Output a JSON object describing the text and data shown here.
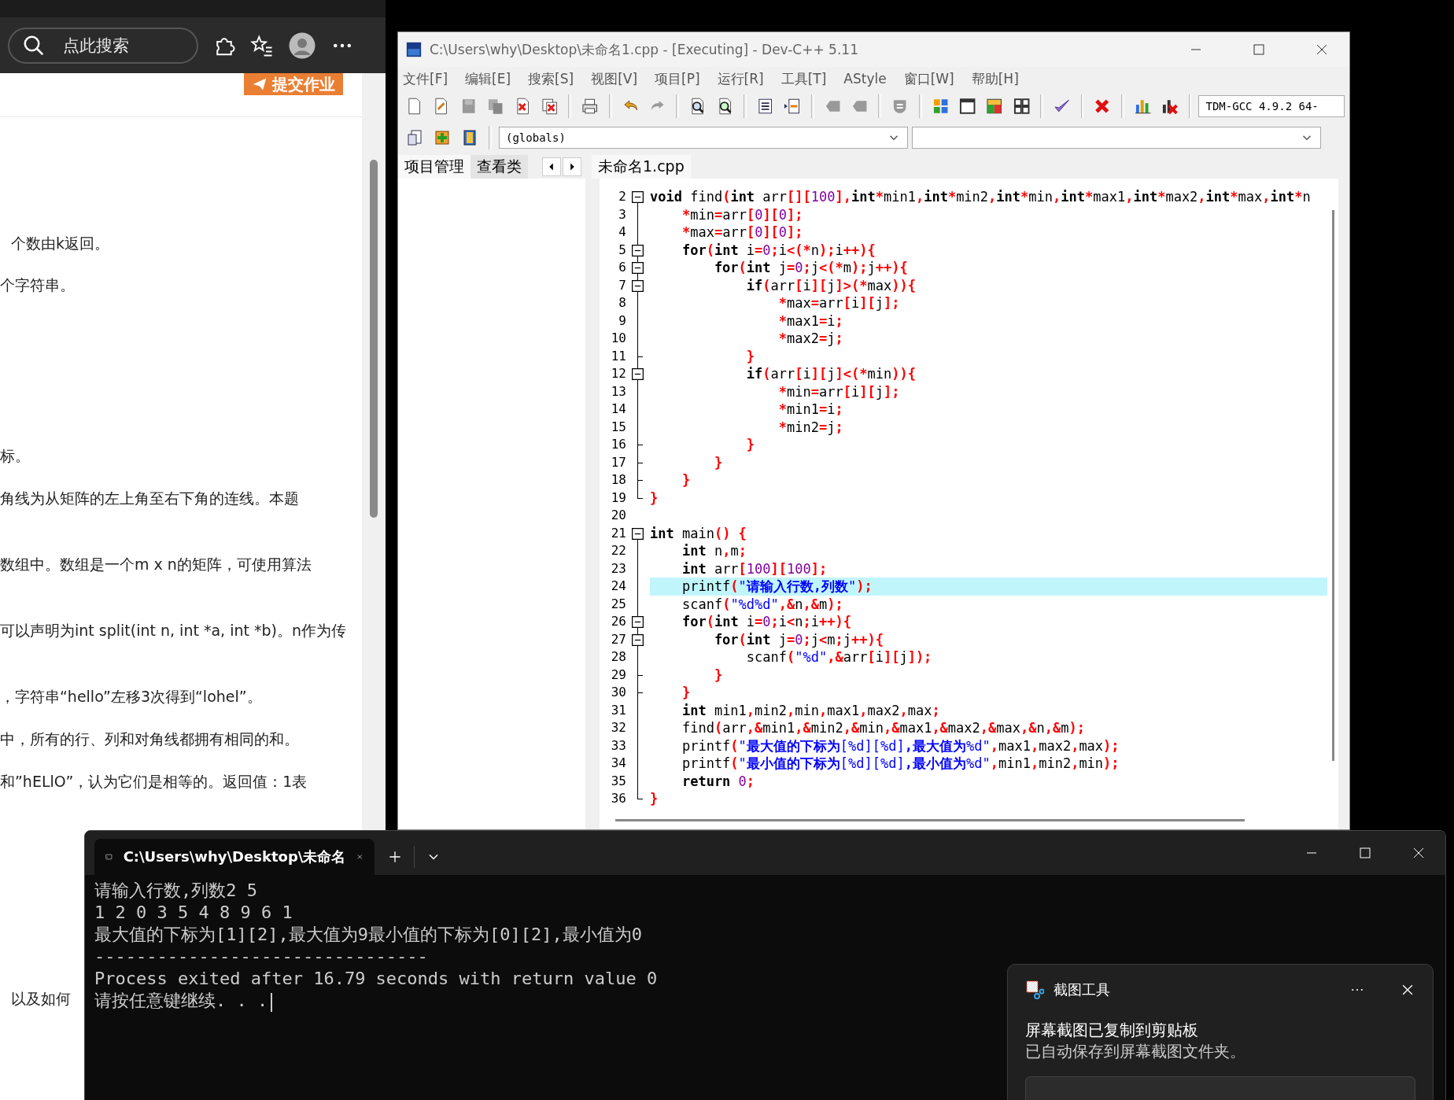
{
  "browser": {
    "search": {
      "placeholder": "点此搜索"
    },
    "submit_button": "提交作业",
    "paragraphs": [
      "个数由k返回。",
      "个字符串。",
      "标。",
      "角线为从矩阵的左上角至右下角的连线。本题",
      "数组中。数组是一个m x n的矩阵，可使用算法",
      "可以声明为int split(int n, int *a, int *b)。n作为传",
      "，字符串“hello”左移3次得到“lohel”。",
      "中，所有的行、列和对角线都拥有相同的和。",
      "和”hELlO”，认为它们是相等的。返回值：1表",
      "以及如何"
    ]
  },
  "devcpp": {
    "title": "C:\\Users\\why\\Desktop\\未命名1.cpp - [Executing] - Dev-C++ 5.11",
    "menu": [
      "文件[F]",
      "编辑[E]",
      "搜索[S]",
      "视图[V]",
      "项目[P]",
      "运行[R]",
      "工具[T]",
      "AStyle",
      "窗口[W]",
      "帮助[H]"
    ],
    "compiler": "TDM-GCC 4.9.2 64-",
    "scope": "(globals)",
    "panel_tabs": [
      {
        "label": "项目管理",
        "selected": true
      },
      {
        "label": "查看类",
        "selected": false
      }
    ],
    "file_tabs": [
      {
        "label": "未命名1.cpp",
        "selected": true
      }
    ],
    "lines": [
      {
        "number": "2",
        "kind": "open",
        "current": false,
        "tokens": [
          {
            "kind": "kw",
            "text": "void"
          },
          {
            "kind": "id",
            "text": " find"
          },
          {
            "kind": "sym",
            "text": "("
          },
          {
            "kind": "kw",
            "text": "int"
          },
          {
            "kind": "id",
            "text": " arr"
          },
          {
            "kind": "sym",
            "text": "[]["
          },
          {
            "kind": "num",
            "text": "100"
          },
          {
            "kind": "sym",
            "text": "],"
          },
          {
            "kind": "kw",
            "text": "int"
          },
          {
            "kind": "sym",
            "text": "*"
          },
          {
            "kind": "id",
            "text": "min1"
          },
          {
            "kind": "sym",
            "text": ","
          },
          {
            "kind": "kw",
            "text": "int"
          },
          {
            "kind": "sym",
            "text": "*"
          },
          {
            "kind": "id",
            "text": "min2"
          },
          {
            "kind": "sym",
            "text": ","
          },
          {
            "kind": "kw",
            "text": "int"
          },
          {
            "kind": "sym",
            "text": "*"
          },
          {
            "kind": "id",
            "text": "min"
          },
          {
            "kind": "sym",
            "text": ","
          },
          {
            "kind": "kw",
            "text": "int"
          },
          {
            "kind": "sym",
            "text": "*"
          },
          {
            "kind": "id",
            "text": "max1"
          },
          {
            "kind": "sym",
            "text": ","
          },
          {
            "kind": "kw",
            "text": "int"
          },
          {
            "kind": "sym",
            "text": "*"
          },
          {
            "kind": "id",
            "text": "max2"
          },
          {
            "kind": "sym",
            "text": ","
          },
          {
            "kind": "kw",
            "text": "int"
          },
          {
            "kind": "sym",
            "text": "*"
          },
          {
            "kind": "id",
            "text": "max"
          },
          {
            "kind": "sym",
            "text": ","
          },
          {
            "kind": "kw",
            "text": "int"
          },
          {
            "kind": "sym",
            "text": "*"
          },
          {
            "kind": "id",
            "text": "n"
          }
        ]
      },
      {
        "number": "3",
        "kind": "line",
        "current": false,
        "tokens": [
          {
            "kind": "sym",
            "text": "    *"
          },
          {
            "kind": "id",
            "text": "min"
          },
          {
            "kind": "sym",
            "text": "="
          },
          {
            "kind": "id",
            "text": "arr"
          },
          {
            "kind": "sym",
            "text": "["
          },
          {
            "kind": "num",
            "text": "0"
          },
          {
            "kind": "sym",
            "text": "]["
          },
          {
            "kind": "num",
            "text": "0"
          },
          {
            "kind": "sym",
            "text": "];"
          }
        ]
      },
      {
        "number": "4",
        "kind": "line",
        "current": false,
        "tokens": [
          {
            "kind": "sym",
            "text": "    *"
          },
          {
            "kind": "id",
            "text": "max"
          },
          {
            "kind": "sym",
            "text": "="
          },
          {
            "kind": "id",
            "text": "arr"
          },
          {
            "kind": "sym",
            "text": "["
          },
          {
            "kind": "num",
            "text": "0"
          },
          {
            "kind": "sym",
            "text": "]["
          },
          {
            "kind": "num",
            "text": "0"
          },
          {
            "kind": "sym",
            "text": "];"
          }
        ]
      },
      {
        "number": "5",
        "kind": "open",
        "current": false,
        "tokens": [
          {
            "kind": "kw",
            "text": "    for"
          },
          {
            "kind": "sym",
            "text": "("
          },
          {
            "kind": "kw",
            "text": "int"
          },
          {
            "kind": "id",
            "text": " i"
          },
          {
            "kind": "sym",
            "text": "="
          },
          {
            "kind": "num",
            "text": "0"
          },
          {
            "kind": "sym",
            "text": ";"
          },
          {
            "kind": "id",
            "text": "i"
          },
          {
            "kind": "sym",
            "text": "<(*"
          },
          {
            "kind": "id",
            "text": "n"
          },
          {
            "kind": "sym",
            "text": ");"
          },
          {
            "kind": "id",
            "text": "i"
          },
          {
            "kind": "sym",
            "text": "++){"
          }
        ]
      },
      {
        "number": "6",
        "kind": "open",
        "current": false,
        "tokens": [
          {
            "kind": "kw",
            "text": "        for"
          },
          {
            "kind": "sym",
            "text": "("
          },
          {
            "kind": "kw",
            "text": "int"
          },
          {
            "kind": "id",
            "text": " j"
          },
          {
            "kind": "sym",
            "text": "="
          },
          {
            "kind": "num",
            "text": "0"
          },
          {
            "kind": "sym",
            "text": ";"
          },
          {
            "kind": "id",
            "text": "j"
          },
          {
            "kind": "sym",
            "text": "<(*"
          },
          {
            "kind": "id",
            "text": "m"
          },
          {
            "kind": "sym",
            "text": ");"
          },
          {
            "kind": "id",
            "text": "j"
          },
          {
            "kind": "sym",
            "text": "++){"
          }
        ]
      },
      {
        "number": "7",
        "kind": "open",
        "current": false,
        "tokens": [
          {
            "kind": "kw",
            "text": "            if"
          },
          {
            "kind": "sym",
            "text": "("
          },
          {
            "kind": "id",
            "text": "arr"
          },
          {
            "kind": "sym",
            "text": "["
          },
          {
            "kind": "id",
            "text": "i"
          },
          {
            "kind": "sym",
            "text": "]["
          },
          {
            "kind": "id",
            "text": "j"
          },
          {
            "kind": "sym",
            "text": "]>(*"
          },
          {
            "kind": "id",
            "text": "max"
          },
          {
            "kind": "sym",
            "text": ")){"
          }
        ]
      },
      {
        "number": "8",
        "kind": "line",
        "current": false,
        "tokens": [
          {
            "kind": "sym",
            "text": "                *"
          },
          {
            "kind": "id",
            "text": "max"
          },
          {
            "kind": "sym",
            "text": "="
          },
          {
            "kind": "id",
            "text": "arr"
          },
          {
            "kind": "sym",
            "text": "["
          },
          {
            "kind": "id",
            "text": "i"
          },
          {
            "kind": "sym",
            "text": "]["
          },
          {
            "kind": "id",
            "text": "j"
          },
          {
            "kind": "sym",
            "text": "];"
          }
        ]
      },
      {
        "number": "9",
        "kind": "line",
        "current": false,
        "tokens": [
          {
            "kind": "sym",
            "text": "                *"
          },
          {
            "kind": "id",
            "text": "max1"
          },
          {
            "kind": "sym",
            "text": "="
          },
          {
            "kind": "id",
            "text": "i"
          },
          {
            "kind": "sym",
            "text": ";"
          }
        ]
      },
      {
        "number": "10",
        "kind": "line",
        "current": false,
        "tokens": [
          {
            "kind": "sym",
            "text": "                *"
          },
          {
            "kind": "id",
            "text": "max2"
          },
          {
            "kind": "sym",
            "text": "="
          },
          {
            "kind": "id",
            "text": "j"
          },
          {
            "kind": "sym",
            "text": ";"
          }
        ]
      },
      {
        "number": "11",
        "kind": "tick",
        "current": false,
        "tokens": [
          {
            "kind": "sym",
            "text": "            }"
          }
        ]
      },
      {
        "number": "12",
        "kind": "open",
        "current": false,
        "tokens": [
          {
            "kind": "kw",
            "text": "            if"
          },
          {
            "kind": "sym",
            "text": "("
          },
          {
            "kind": "id",
            "text": "arr"
          },
          {
            "kind": "sym",
            "text": "["
          },
          {
            "kind": "id",
            "text": "i"
          },
          {
            "kind": "sym",
            "text": "]["
          },
          {
            "kind": "id",
            "text": "j"
          },
          {
            "kind": "sym",
            "text": "]<(*"
          },
          {
            "kind": "id",
            "text": "min"
          },
          {
            "kind": "sym",
            "text": ")){"
          }
        ]
      },
      {
        "number": "13",
        "kind": "line",
        "current": false,
        "tokens": [
          {
            "kind": "sym",
            "text": "                *"
          },
          {
            "kind": "id",
            "text": "min"
          },
          {
            "kind": "sym",
            "text": "="
          },
          {
            "kind": "id",
            "text": "arr"
          },
          {
            "kind": "sym",
            "text": "["
          },
          {
            "kind": "id",
            "text": "i"
          },
          {
            "kind": "sym",
            "text": "]["
          },
          {
            "kind": "id",
            "text": "j"
          },
          {
            "kind": "sym",
            "text": "];"
          }
        ]
      },
      {
        "number": "14",
        "kind": "line",
        "current": false,
        "tokens": [
          {
            "kind": "sym",
            "text": "                *"
          },
          {
            "kind": "id",
            "text": "min1"
          },
          {
            "kind": "sym",
            "text": "="
          },
          {
            "kind": "id",
            "text": "i"
          },
          {
            "kind": "sym",
            "text": ";"
          }
        ]
      },
      {
        "number": "15",
        "kind": "line",
        "current": false,
        "tokens": [
          {
            "kind": "sym",
            "text": "                *"
          },
          {
            "kind": "id",
            "text": "min2"
          },
          {
            "kind": "sym",
            "text": "="
          },
          {
            "kind": "id",
            "text": "j"
          },
          {
            "kind": "sym",
            "text": ";"
          }
        ]
      },
      {
        "number": "16",
        "kind": "tick",
        "current": false,
        "tokens": [
          {
            "kind": "sym",
            "text": "            }"
          }
        ]
      },
      {
        "number": "17",
        "kind": "tick",
        "current": false,
        "tokens": [
          {
            "kind": "sym",
            "text": "        }"
          }
        ]
      },
      {
        "number": "18",
        "kind": "tick",
        "current": false,
        "tokens": [
          {
            "kind": "sym",
            "text": "    }"
          }
        ]
      },
      {
        "number": "19",
        "kind": "end",
        "current": false,
        "tokens": [
          {
            "kind": "sym",
            "text": "}"
          }
        ]
      },
      {
        "number": "20",
        "kind": "none",
        "current": false
      },
      {
        "number": "21",
        "kind": "open",
        "current": false,
        "tokens": [
          {
            "kind": "kw",
            "text": "int"
          },
          {
            "kind": "id",
            "text": " main"
          },
          {
            "kind": "sym",
            "text": "() {"
          }
        ]
      },
      {
        "number": "22",
        "kind": "line",
        "current": false,
        "tokens": [
          {
            "kind": "kw",
            "text": "    int"
          },
          {
            "kind": "id",
            "text": " n"
          },
          {
            "kind": "sym",
            "text": ","
          },
          {
            "kind": "id",
            "text": "m"
          },
          {
            "kind": "sym",
            "text": ";"
          }
        ]
      },
      {
        "number": "23",
        "kind": "line",
        "current": false,
        "tokens": [
          {
            "kind": "kw",
            "text": "    int"
          },
          {
            "kind": "id",
            "text": " arr"
          },
          {
            "kind": "sym",
            "text": "["
          },
          {
            "kind": "num",
            "text": "100"
          },
          {
            "kind": "sym",
            "text": "]["
          },
          {
            "kind": "num",
            "text": "100"
          },
          {
            "kind": "sym",
            "text": "];"
          }
        ]
      },
      {
        "number": "24",
        "kind": "line",
        "current": true,
        "tokens": [
          {
            "kind": "id",
            "text": "    printf"
          },
          {
            "kind": "sym",
            "text": "("
          },
          {
            "kind": "str",
            "text": "\""
          },
          {
            "kind": "cn",
            "text": "请输入行数,列数"
          },
          {
            "kind": "str",
            "text": "\""
          },
          {
            "kind": "sym",
            "text": ");"
          }
        ]
      },
      {
        "number": "25",
        "kind": "line",
        "current": false,
        "tokens": [
          {
            "kind": "id",
            "text": "    scanf"
          },
          {
            "kind": "sym",
            "text": "("
          },
          {
            "kind": "str",
            "text": "\"%d%d\""
          },
          {
            "kind": "sym",
            "text": ",&"
          },
          {
            "kind": "id",
            "text": "n"
          },
          {
            "kind": "sym",
            "text": ",&"
          },
          {
            "kind": "id",
            "text": "m"
          },
          {
            "kind": "sym",
            "text": ");"
          }
        ]
      },
      {
        "number": "26",
        "kind": "open",
        "current": false,
        "tokens": [
          {
            "kind": "kw",
            "text": "    for"
          },
          {
            "kind": "sym",
            "text": "("
          },
          {
            "kind": "kw",
            "text": "int"
          },
          {
            "kind": "id",
            "text": " i"
          },
          {
            "kind": "sym",
            "text": "="
          },
          {
            "kind": "num",
            "text": "0"
          },
          {
            "kind": "sym",
            "text": ";"
          },
          {
            "kind": "id",
            "text": "i"
          },
          {
            "kind": "sym",
            "text": "<"
          },
          {
            "kind": "id",
            "text": "n"
          },
          {
            "kind": "sym",
            "text": ";"
          },
          {
            "kind": "id",
            "text": "i"
          },
          {
            "kind": "sym",
            "text": "++){"
          }
        ]
      },
      {
        "number": "27",
        "kind": "open",
        "current": false,
        "tokens": [
          {
            "kind": "kw",
            "text": "        for"
          },
          {
            "kind": "sym",
            "text": "("
          },
          {
            "kind": "kw",
            "text": "int"
          },
          {
            "kind": "id",
            "text": " j"
          },
          {
            "kind": "sym",
            "text": "="
          },
          {
            "kind": "num",
            "text": "0"
          },
          {
            "kind": "sym",
            "text": ";"
          },
          {
            "kind": "id",
            "text": "j"
          },
          {
            "kind": "sym",
            "text": "<"
          },
          {
            "kind": "id",
            "text": "m"
          },
          {
            "kind": "sym",
            "text": ";"
          },
          {
            "kind": "id",
            "text": "j"
          },
          {
            "kind": "sym",
            "text": "++){"
          }
        ]
      },
      {
        "number": "28",
        "kind": "line",
        "current": false,
        "tokens": [
          {
            "kind": "id",
            "text": "            scanf"
          },
          {
            "kind": "sym",
            "text": "("
          },
          {
            "kind": "str",
            "text": "\"%d\""
          },
          {
            "kind": "sym",
            "text": ",&"
          },
          {
            "kind": "id",
            "text": "arr"
          },
          {
            "kind": "sym",
            "text": "["
          },
          {
            "kind": "id",
            "text": "i"
          },
          {
            "kind": "sym",
            "text": "]["
          },
          {
            "kind": "id",
            "text": "j"
          },
          {
            "kind": "sym",
            "text": "]);"
          }
        ]
      },
      {
        "number": "29",
        "kind": "tick",
        "current": false,
        "tokens": [
          {
            "kind": "sym",
            "text": "        }"
          }
        ]
      },
      {
        "number": "30",
        "kind": "tick",
        "current": false,
        "tokens": [
          {
            "kind": "sym",
            "text": "    }"
          }
        ]
      },
      {
        "number": "31",
        "kind": "line",
        "current": false,
        "tokens": [
          {
            "kind": "kw",
            "text": "    int"
          },
          {
            "kind": "id",
            "text": " min1"
          },
          {
            "kind": "sym",
            "text": ","
          },
          {
            "kind": "id",
            "text": "min2"
          },
          {
            "kind": "sym",
            "text": ","
          },
          {
            "kind": "id",
            "text": "min"
          },
          {
            "kind": "sym",
            "text": ","
          },
          {
            "kind": "id",
            "text": "max1"
          },
          {
            "kind": "sym",
            "text": ","
          },
          {
            "kind": "id",
            "text": "max2"
          },
          {
            "kind": "sym",
            "text": ","
          },
          {
            "kind": "id",
            "text": "max"
          },
          {
            "kind": "sym",
            "text": ";"
          }
        ]
      },
      {
        "number": "32",
        "kind": "line",
        "current": false,
        "tokens": [
          {
            "kind": "id",
            "text": "    find"
          },
          {
            "kind": "sym",
            "text": "("
          },
          {
            "kind": "id",
            "text": "arr"
          },
          {
            "kind": "sym",
            "text": ",&"
          },
          {
            "kind": "id",
            "text": "min1"
          },
          {
            "kind": "sym",
            "text": ",&"
          },
          {
            "kind": "id",
            "text": "min2"
          },
          {
            "kind": "sym",
            "text": ",&"
          },
          {
            "kind": "id",
            "text": "min"
          },
          {
            "kind": "sym",
            "text": ",&"
          },
          {
            "kind": "id",
            "text": "max1"
          },
          {
            "kind": "sym",
            "text": ",&"
          },
          {
            "kind": "id",
            "text": "max2"
          },
          {
            "kind": "sym",
            "text": ",&"
          },
          {
            "kind": "id",
            "text": "max"
          },
          {
            "kind": "sym",
            "text": ",&"
          },
          {
            "kind": "id",
            "text": "n"
          },
          {
            "kind": "sym",
            "text": ",&"
          },
          {
            "kind": "id",
            "text": "m"
          },
          {
            "kind": "sym",
            "text": ");"
          }
        ]
      },
      {
        "number": "33",
        "kind": "line",
        "current": false,
        "tokens": [
          {
            "kind": "id",
            "text": "    printf"
          },
          {
            "kind": "sym",
            "text": "("
          },
          {
            "kind": "str",
            "text": "\""
          },
          {
            "kind": "cn",
            "text": "最大值的下标为"
          },
          {
            "kind": "str",
            "text": "[%d][%d]"
          },
          {
            "kind": "cn",
            "text": ",最大值为"
          },
          {
            "kind": "str",
            "text": "%d\""
          },
          {
            "kind": "sym",
            "text": ","
          },
          {
            "kind": "id",
            "text": "max1"
          },
          {
            "kind": "sym",
            "text": ","
          },
          {
            "kind": "id",
            "text": "max2"
          },
          {
            "kind": "sym",
            "text": ","
          },
          {
            "kind": "id",
            "text": "max"
          },
          {
            "kind": "sym",
            "text": ");"
          }
        ]
      },
      {
        "number": "34",
        "kind": "line",
        "current": false,
        "tokens": [
          {
            "kind": "id",
            "text": "    printf"
          },
          {
            "kind": "sym",
            "text": "("
          },
          {
            "kind": "str",
            "text": "\""
          },
          {
            "kind": "cn",
            "text": "最小值的下标为"
          },
          {
            "kind": "str",
            "text": "[%d][%d]"
          },
          {
            "kind": "cn",
            "text": ",最小值为"
          },
          {
            "kind": "str",
            "text": "%d\""
          },
          {
            "kind": "sym",
            "text": ","
          },
          {
            "kind": "id",
            "text": "min1"
          },
          {
            "kind": "sym",
            "text": ","
          },
          {
            "kind": "id",
            "text": "min2"
          },
          {
            "kind": "sym",
            "text": ","
          },
          {
            "kind": "id",
            "text": "min"
          },
          {
            "kind": "sym",
            "text": ");"
          }
        ]
      },
      {
        "number": "35",
        "kind": "line",
        "current": false,
        "tokens": [
          {
            "kind": "kw",
            "text": "    return "
          },
          {
            "kind": "num",
            "text": "0"
          },
          {
            "kind": "sym",
            "text": ";"
          }
        ]
      },
      {
        "number": "36",
        "kind": "end",
        "current": false,
        "tokens": [
          {
            "kind": "sym",
            "text": "}"
          }
        ]
      }
    ]
  },
  "terminal": {
    "tab_title": "C:\\Users\\why\\Desktop\\未命名",
    "lines": [
      "请输入行数,列数2 5",
      "1 2 0 3 5 4 8 9 6 1",
      "最大值的下标为[1][2],最大值为9最小值的下标为[0][2],最小值为0",
      "--------------------------------",
      "Process exited after 16.79 seconds with return value 0",
      "请按任意键继续. . ."
    ]
  },
  "notification": {
    "app": "截图工具",
    "title": "屏幕截图已复制到剪贴板",
    "body": "已自动保存到屏幕截图文件夹。"
  }
}
